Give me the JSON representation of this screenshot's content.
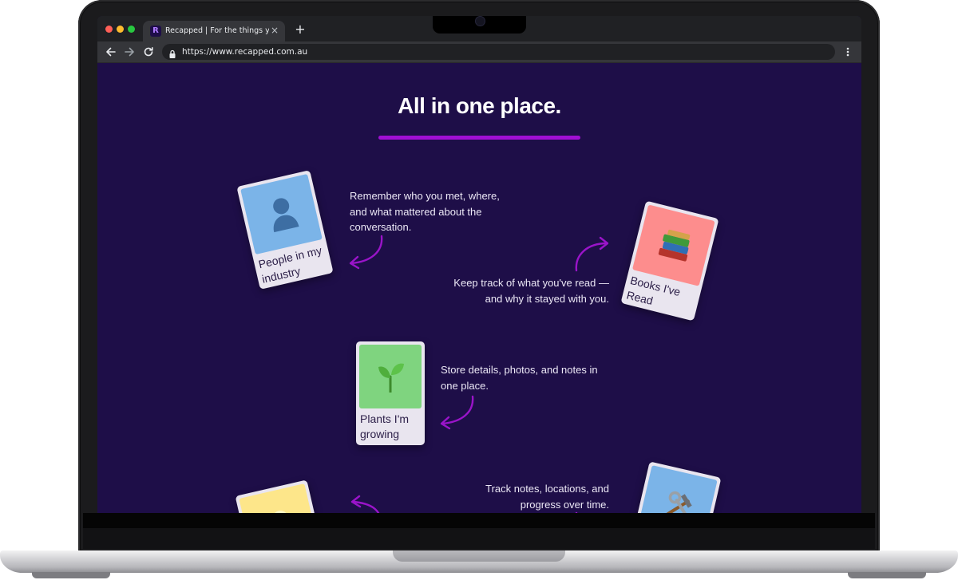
{
  "browser": {
    "tab_title": "Recapped | For the things you care about",
    "tab_close": "×",
    "new_tab": "+",
    "url": "https://www.recapped.com.au",
    "favicon": "R"
  },
  "page": {
    "title": "All in one place.",
    "accent_color": "#a10fd3",
    "background_color": "#1e0e48",
    "items": [
      {
        "label": "People in my industry",
        "emoji": "👤",
        "icon": "person-silhouette-icon",
        "art_color": "#7bb4e8",
        "description": "Remember who you met, where, and what mattered about the conversation."
      },
      {
        "label": "Books I've Read",
        "emoji": "📚",
        "icon": "books-icon",
        "art_color": "#fd8d8d",
        "description": "Keep track of what you've read — and why it stayed with you."
      },
      {
        "label": "Plants I'm growing",
        "emoji": "🌱",
        "icon": "seedling-icon",
        "art_color": "#7fd47f",
        "description": "Store details, photos, and notes in one place."
      },
      {
        "label": "",
        "emoji": "💡",
        "icon": "lightbulb-icon",
        "art_color": "#fde68a",
        "description": ""
      },
      {
        "label": "",
        "emoji": "🛠",
        "icon": "hammer-wrench-icon",
        "art_color": "#7bb4e8",
        "description": "Track notes, locations, and progress over time."
      }
    ]
  }
}
